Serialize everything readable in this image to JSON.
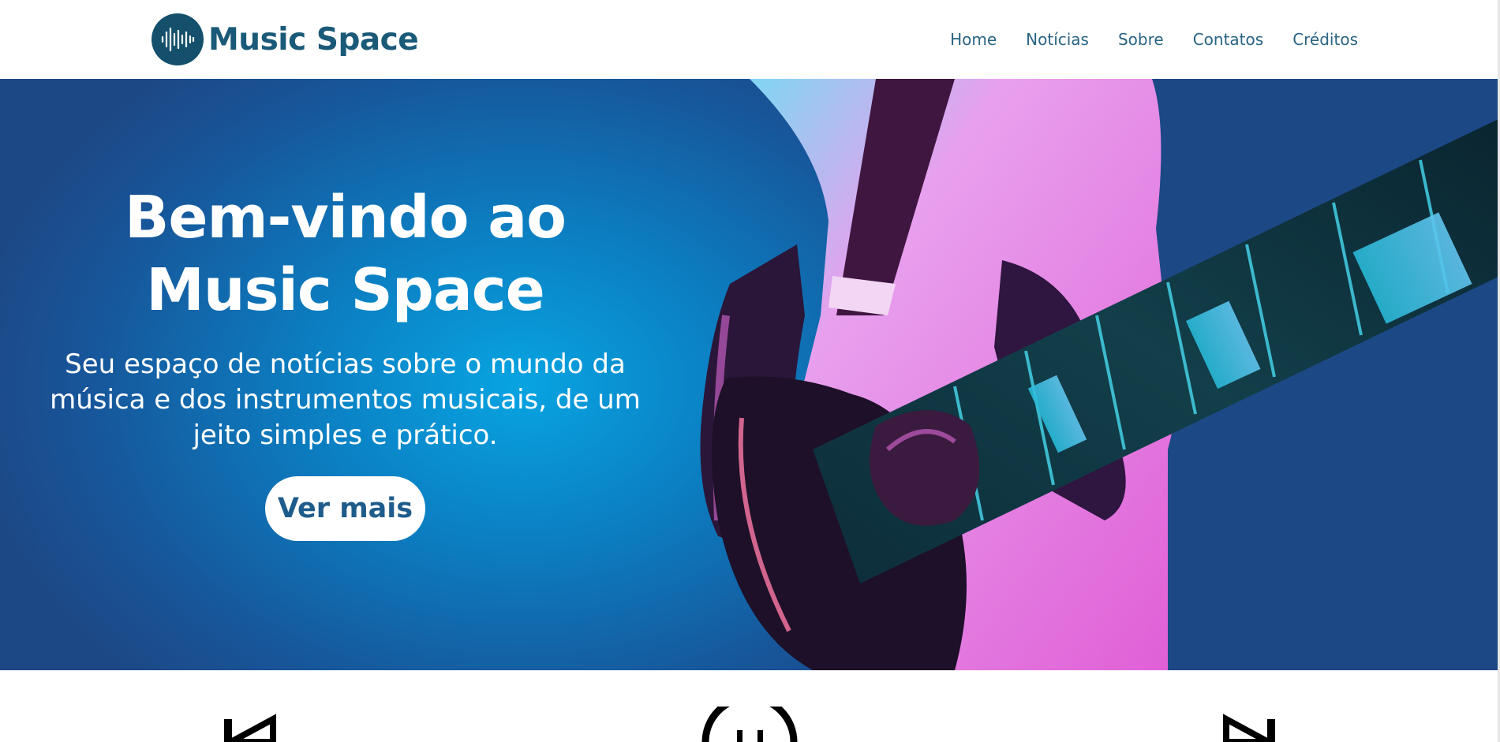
{
  "header": {
    "brand_name": "Music Space",
    "logo_icon": "sound-wave-icon",
    "nav": [
      {
        "label": "Home"
      },
      {
        "label": "Notícias"
      },
      {
        "label": "Sobre"
      },
      {
        "label": "Contatos"
      },
      {
        "label": "Créditos"
      }
    ]
  },
  "hero": {
    "title_line1": "Bem-vindo ao",
    "title_line2": "Music Space",
    "subtitle": "Seu espaço de notícias sobre o mundo da música e dos instrumentos musicais, de um jeito simples e prático.",
    "cta_label": "Ver mais",
    "image": "guitarist-photo"
  },
  "features": {
    "icons": [
      "skip-back-icon",
      "face-icon",
      "skip-forward-icon"
    ]
  },
  "colors": {
    "brand": "#1a5a78",
    "logo_bg": "#14506b",
    "hero_center": "#08a4e2",
    "hero_edge": "#1d4886",
    "cta_text": "#1e5c8c"
  }
}
